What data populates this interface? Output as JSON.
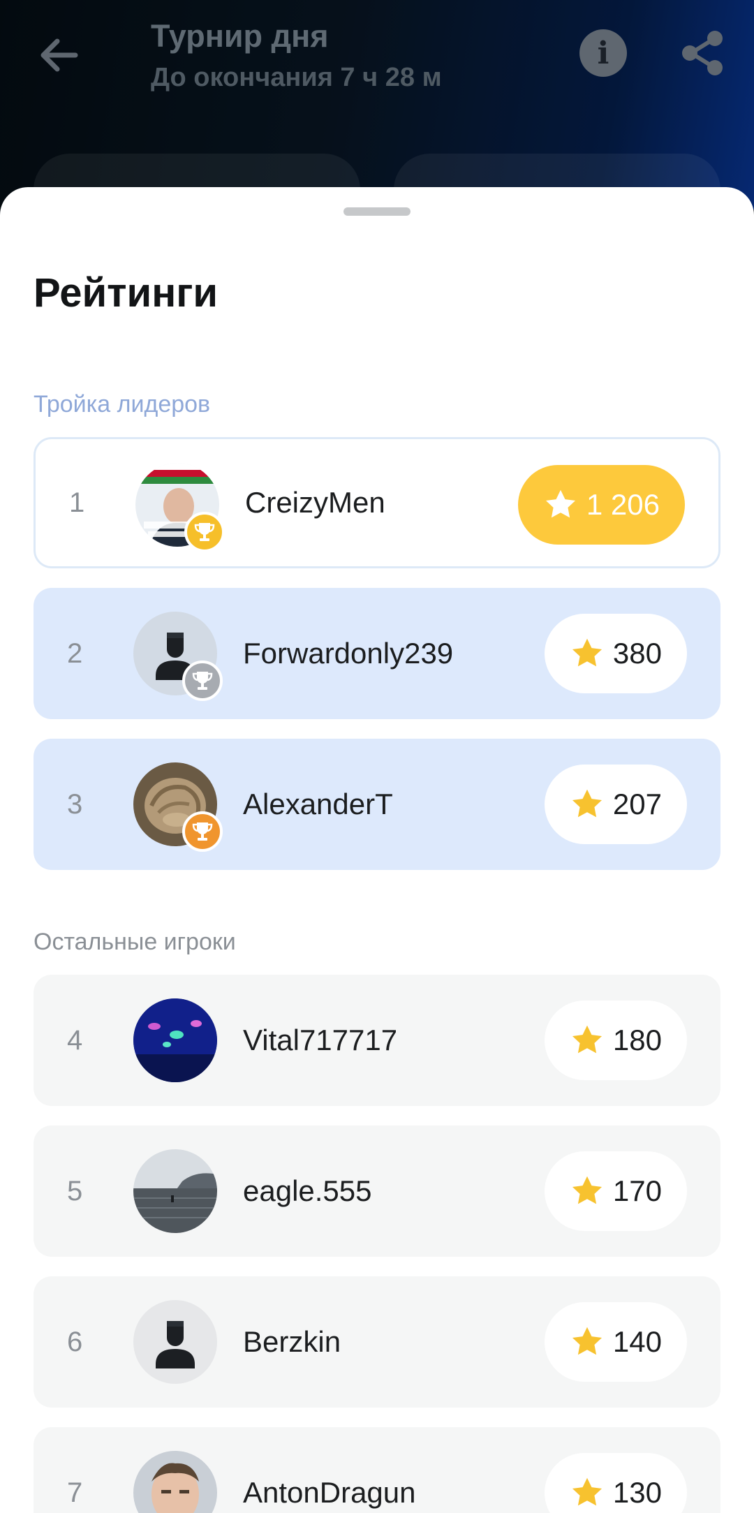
{
  "header": {
    "title": "Турнир дня",
    "subtitle": "До окончания 7 ч 28 м",
    "back_icon": "arrow-left-icon",
    "info_icon": "info-icon",
    "info_glyph": "i",
    "share_icon": "share-icon"
  },
  "sheet": {
    "title": "Рейтинги",
    "leaders_label": "Тройка лидеров",
    "others_label": "Остальные игроки"
  },
  "leaders": [
    {
      "rank": "1",
      "name": "CreizyMen",
      "score": "1 206",
      "trophy": "gold"
    },
    {
      "rank": "2",
      "name": "Forwardonly239",
      "score": "380",
      "trophy": "silver"
    },
    {
      "rank": "3",
      "name": "AlexanderT",
      "score": "207",
      "trophy": "bronze"
    }
  ],
  "others": [
    {
      "rank": "4",
      "name": "Vital717717",
      "score": "180"
    },
    {
      "rank": "5",
      "name": "eagle.555",
      "score": "170"
    },
    {
      "rank": "6",
      "name": "Berzkin",
      "score": "140"
    },
    {
      "rank": "7",
      "name": "AntonDragun",
      "score": "130"
    }
  ],
  "colors": {
    "accent_gold": "#fdc93c",
    "star": "#f7c22f",
    "leader_row": "#dde9fc",
    "other_row": "#f5f6f6",
    "trophy_gold": "#f6bf2a",
    "trophy_silver": "#a7abb1",
    "trophy_bronze": "#f0952e"
  }
}
